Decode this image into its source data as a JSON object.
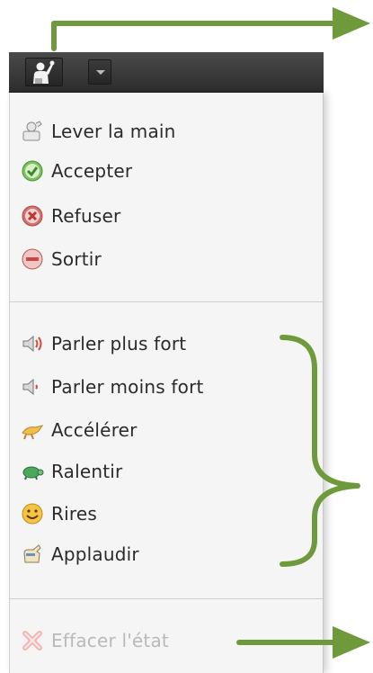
{
  "status_menu": {
    "groups": [
      [
        {
          "label": "Lever la main",
          "icon": "raise-hand-icon"
        },
        {
          "label": "Accepter",
          "icon": "accept-icon"
        },
        {
          "label": "Refuser",
          "icon": "refuse-icon"
        },
        {
          "label": "Sortir",
          "icon": "exit-icon"
        }
      ],
      [
        {
          "label": "Parler plus fort",
          "icon": "speaker-louder-icon"
        },
        {
          "label": "Parler moins fort",
          "icon": "speaker-softer-icon"
        },
        {
          "label": "Accélérer",
          "icon": "speed-up-icon"
        },
        {
          "label": "Ralentir",
          "icon": "slow-down-icon"
        },
        {
          "label": "Rires",
          "icon": "smiley-icon"
        },
        {
          "label": "Applaudir",
          "icon": "applause-icon"
        }
      ],
      [
        {
          "label": "Effacer l'état",
          "icon": "clear-status-icon",
          "disabled": true
        }
      ]
    ]
  },
  "toolbar": {
    "status_button_icon": "user-raise-hand-icon",
    "dropdown_icon": "chevron-down-icon"
  },
  "colors": {
    "toolbar_bg": "#333333",
    "menu_bg": "#f5f5f5",
    "annotation": "#6f9a3c",
    "text": "#2b2b2b",
    "disabled_text": "#b9b9b9"
  }
}
